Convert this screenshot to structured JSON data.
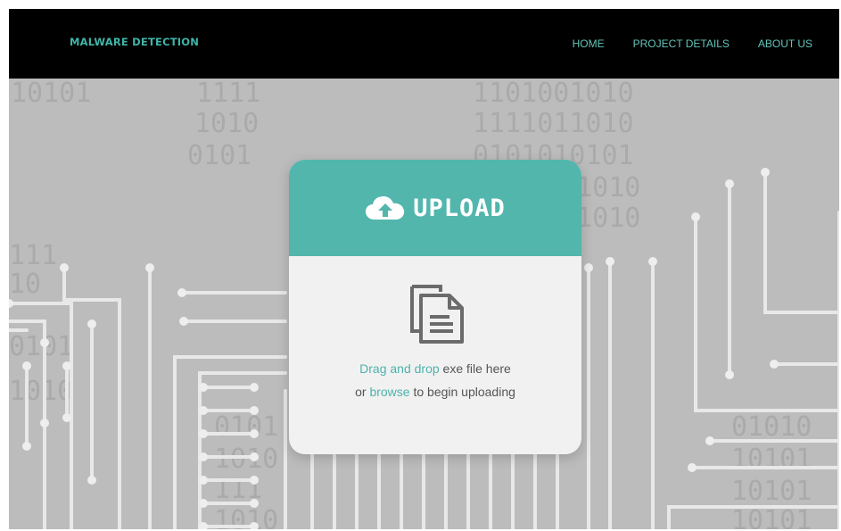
{
  "brand": {
    "title": "MALWARE DETECTION"
  },
  "nav": {
    "items": [
      {
        "label": "HOME"
      },
      {
        "label": "PROJECT DETAILS"
      },
      {
        "label": "ABOUT US"
      }
    ]
  },
  "upload_card": {
    "title": "UPLOAD",
    "line1_link": "Drag and drop",
    "line1_rest": " exe file here",
    "line2_prefix": "or ",
    "line2_link": "browse",
    "line2_rest": " to begin uploading",
    "cloud_icon": "cloud-upload-icon",
    "document_icon": "documents-icon"
  },
  "background": {
    "binary_rows": [
      "10101",
      "1111",
      "1010",
      "0101",
      "1101001010",
      "1111011010",
      "0101010101",
      "011010",
      "111010",
      "111",
      "10",
      "0101",
      "1010",
      "01010",
      "10101",
      "10101",
      "10101",
      "0101",
      "1010",
      "111",
      "1010"
    ]
  },
  "colors": {
    "brand": "#3fb5a8",
    "nav_text": "#62c3b9",
    "accent": "#4db3ad",
    "card_header": "#52b6ad",
    "navbar_bg": "#000000",
    "background": "#bcbcbc",
    "circuit": "#e8e8e8"
  }
}
